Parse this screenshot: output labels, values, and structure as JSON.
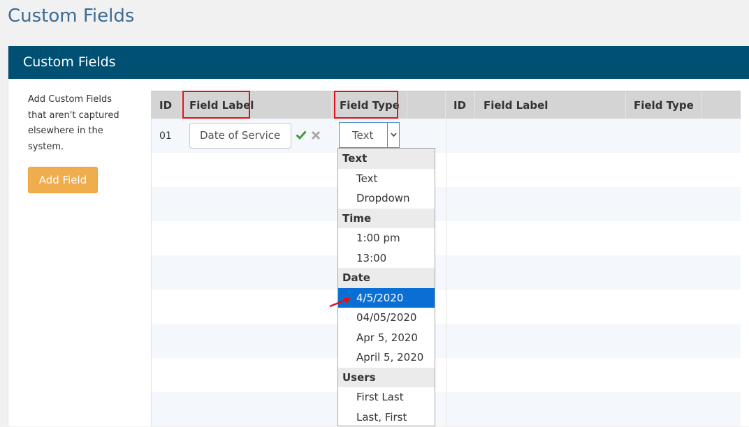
{
  "page_title": "Custom Fields",
  "panel": {
    "title": "Custom Fields",
    "intro_lines": [
      "Add Custom Fields",
      "that aren't captured",
      "elsewhere in the",
      "system."
    ],
    "add_button": "Add Field"
  },
  "table": {
    "headers_left": {
      "id": "ID",
      "label": "Field Label",
      "type": "Field Type"
    },
    "headers_right": {
      "id": "ID",
      "label": "Field Label",
      "type": "Field Type"
    },
    "row": {
      "id": "01",
      "label_value": "Date of Service",
      "type_value": "Text"
    }
  },
  "dropdown": {
    "groups": [
      {
        "label": "Text",
        "options": [
          "Text",
          "Dropdown"
        ]
      },
      {
        "label": "Time",
        "options": [
          "1:00 pm",
          "13:00"
        ]
      },
      {
        "label": "Date",
        "options": [
          "4/5/2020",
          "04/05/2020",
          "Apr 5, 2020",
          "April 5, 2020"
        ]
      },
      {
        "label": "Users",
        "options": [
          "First Last",
          "Last, First"
        ]
      }
    ],
    "selected": "4/5/2020"
  },
  "colors": {
    "header_bar": "#005073",
    "title_text": "#3d6b95",
    "button": "#f0ad4e",
    "highlight_box": "#e0111b",
    "selected_option": "#0a6fd4",
    "check": "#3c9a3c"
  }
}
